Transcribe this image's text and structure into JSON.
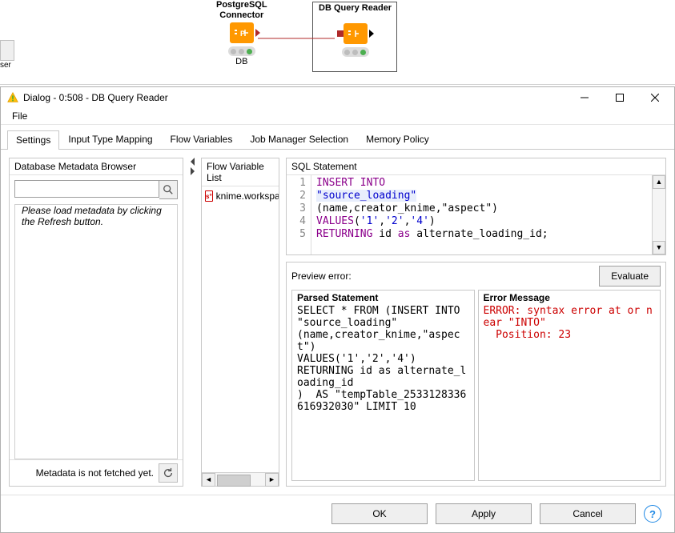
{
  "canvas": {
    "node1": {
      "label_l1": "PostgreSQL",
      "label_l2": "Connector",
      "annot": "DB"
    },
    "node2": {
      "label_l1": "DB Query Reader",
      "label_l2": ""
    }
  },
  "dialog": {
    "title": "Dialog - 0:508 - DB Query Reader",
    "menu": {
      "file": "File"
    },
    "tabs": {
      "settings": "Settings",
      "input_mapping": "Input Type Mapping",
      "flow_vars": "Flow Variables",
      "job_mgr": "Job Manager Selection",
      "mem_policy": "Memory Policy"
    },
    "metadata": {
      "header": "Database Metadata Browser",
      "search_placeholder": "",
      "hint": "Please load metadata by clicking the Refresh button.",
      "footer_text": "Metadata is not fetched yet."
    },
    "flow_var_panel": {
      "header": "Flow Variable List",
      "item": "knime.workspa"
    },
    "sql": {
      "header": "SQL Statement",
      "lines": {
        "n1": "1",
        "n2": "2",
        "n3": "3",
        "n4": "4",
        "n5": "5"
      },
      "l1a": "INSERT",
      "l1b": " INTO",
      "l2": "\"source_loading\"",
      "l3": "(name,creator_knime,\"aspect\")",
      "l4a": "VALUES",
      "l4b": "(",
      "l4c": "'1'",
      "l4d": ",",
      "l4e": "'2'",
      "l4f": ",",
      "l4g": "'4'",
      "l4h": ")",
      "l5a": "RETURNING",
      "l5b": " id ",
      "l5c": "as",
      "l5d": " alternate_loading_id;"
    },
    "preview": {
      "header_label": "Preview error:",
      "evaluate": "Evaluate",
      "parsed_title": "Parsed Statement",
      "parsed_body": "SELECT * FROM (INSERT INTO \"source_loading\"\n(name,creator_knime,\"aspect\")\nVALUES('1','2','4')\nRETURNING id as alternate_loading_id\n)  AS \"tempTable_2533128336616932030\" LIMIT 10",
      "error_title": "Error Message",
      "error_body": "ERROR: syntax error at or near \"INTO\"\n  Position: 23"
    },
    "buttons": {
      "ok": "OK",
      "apply": "Apply",
      "cancel": "Cancel"
    }
  },
  "sliver_label": "ser"
}
